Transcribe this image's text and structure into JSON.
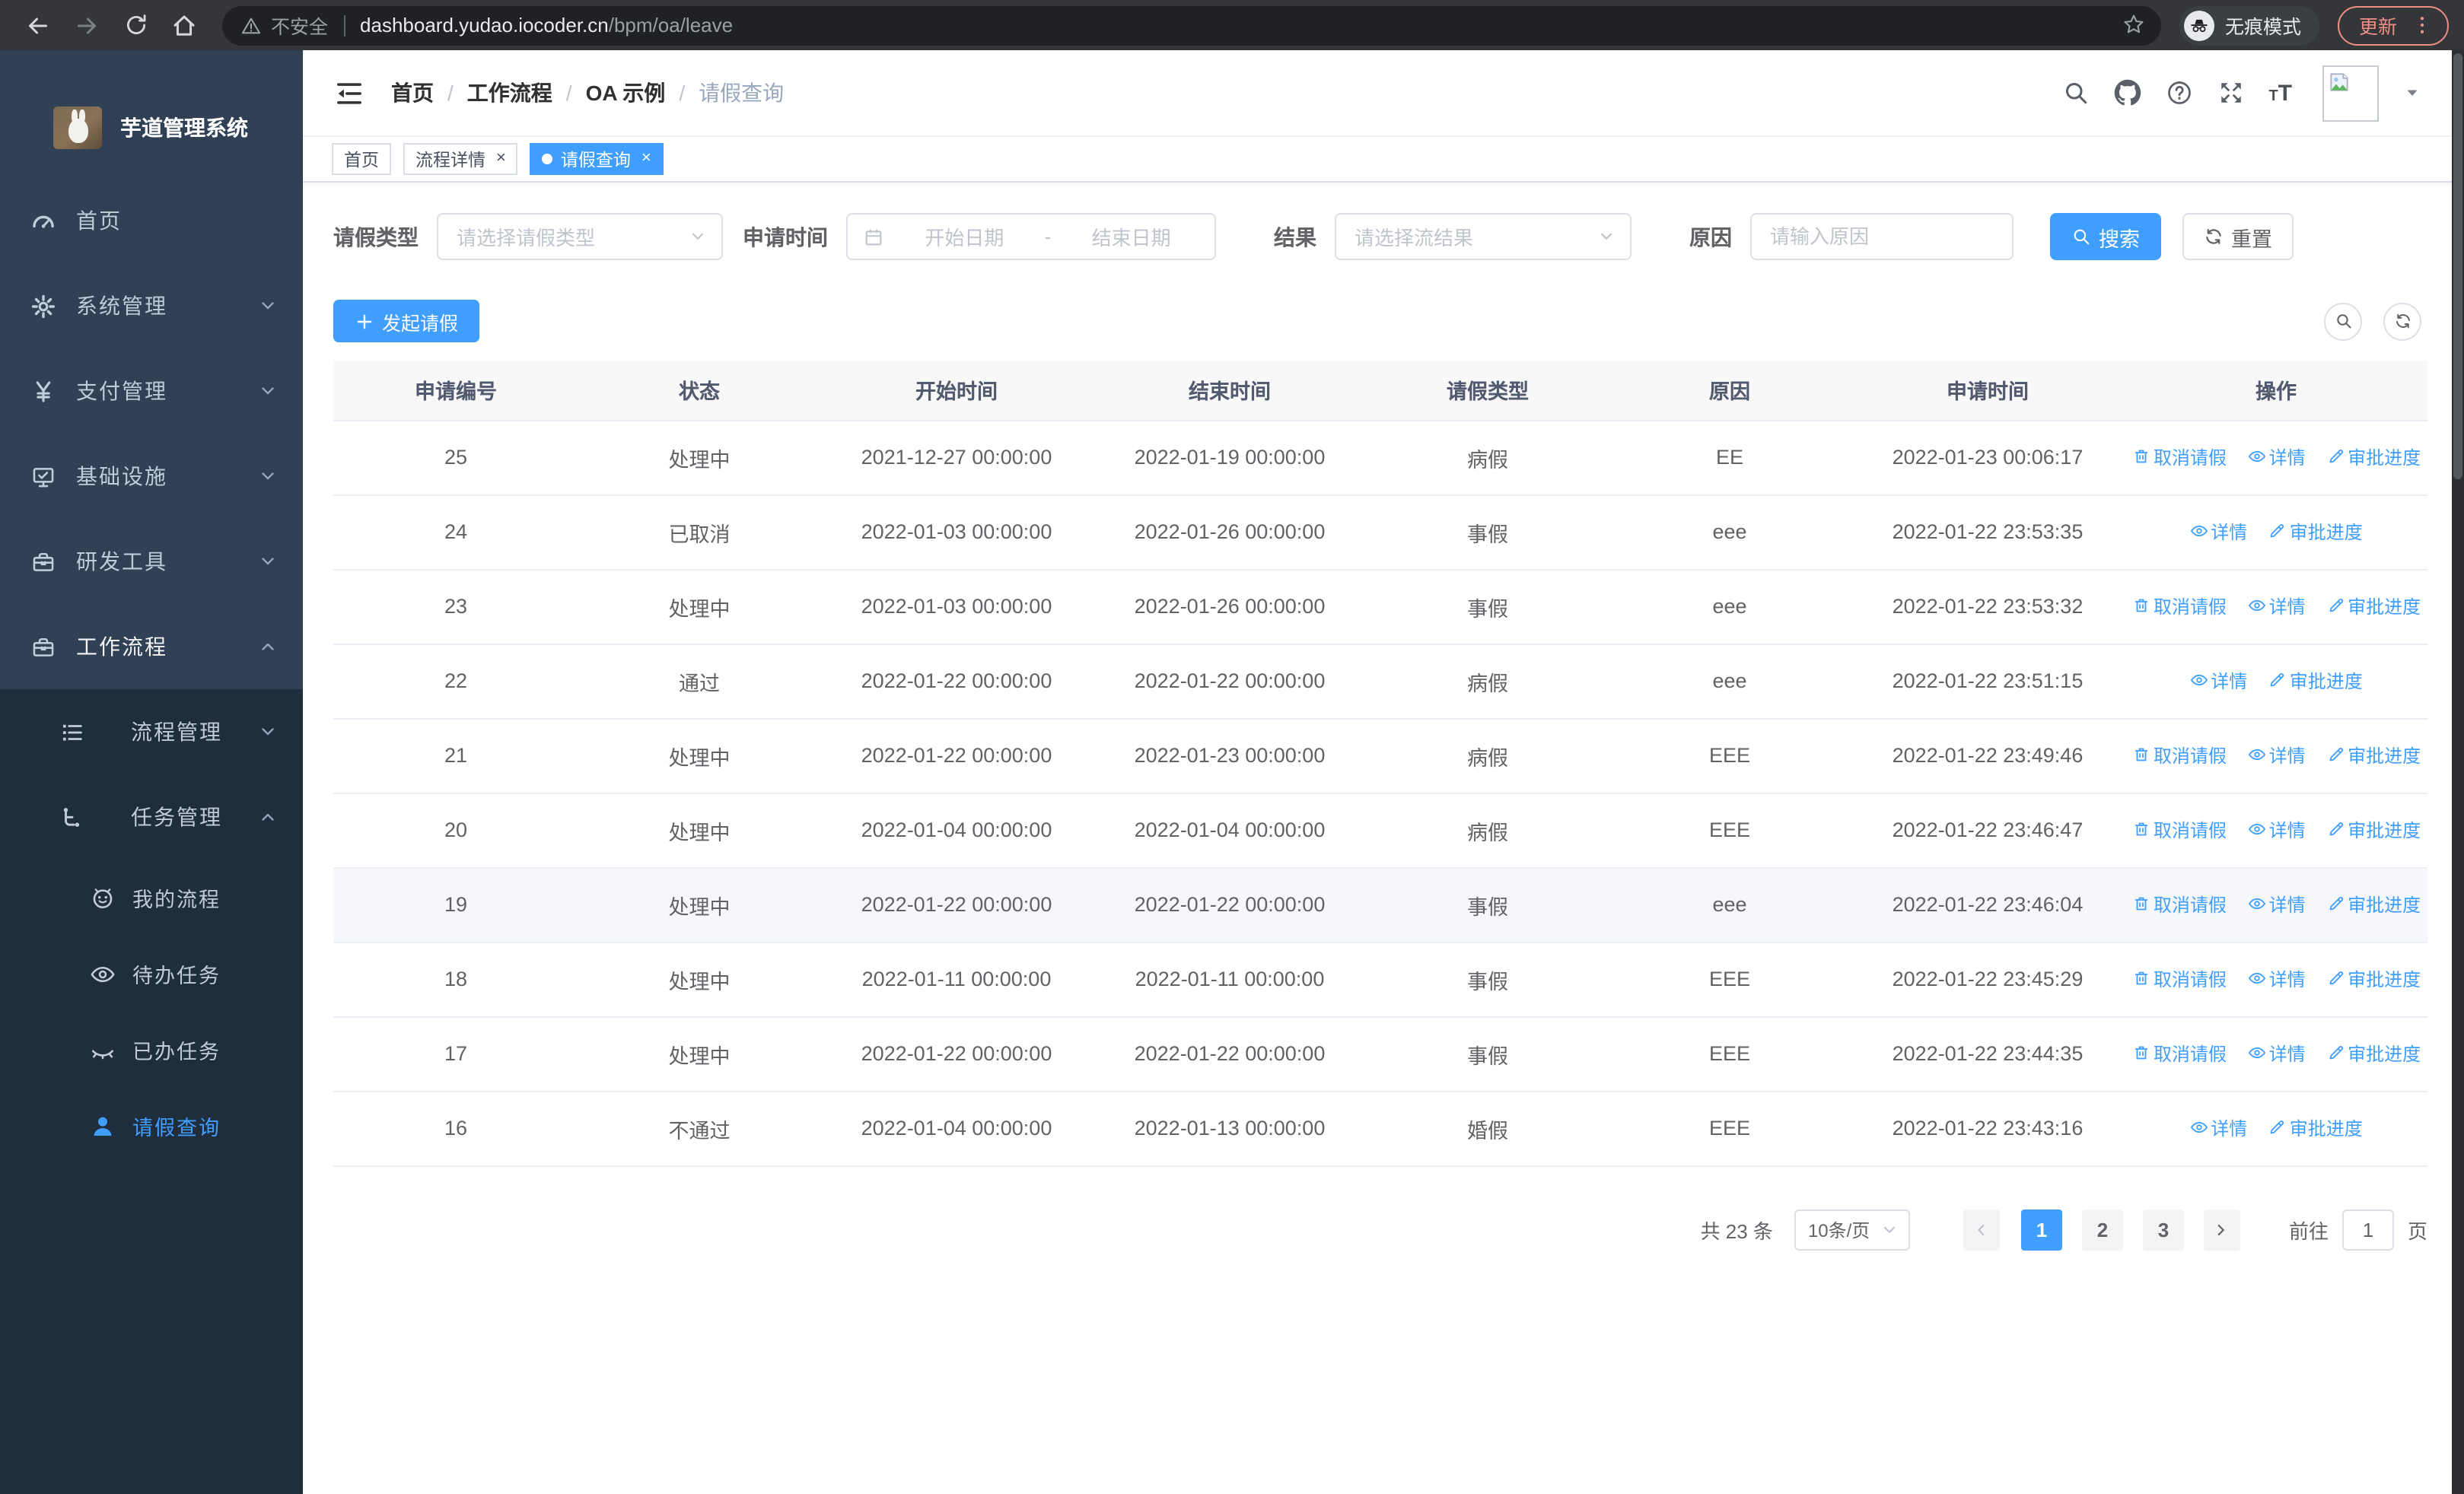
{
  "colors": {
    "accent": "#409eff",
    "sidebar_bg": "#304156",
    "submenu_bg": "#1f2d3d",
    "sidebar_text": "#bfcbd9",
    "link": "#409eff",
    "update_badge": "#ee9087"
  },
  "browser": {
    "security_label": "不安全",
    "url_host": "dashboard.yudao.iocoder.cn",
    "url_path": "/bpm/oa/leave",
    "incognito_label": "无痕模式",
    "update_label": "更新"
  },
  "sidebar": {
    "title": "芋道管理系统",
    "items": [
      {
        "label": "首页",
        "icon": "#i-gauge",
        "level": "1",
        "chevron": "none"
      },
      {
        "label": "系统管理",
        "icon": "#i-gear",
        "level": "1",
        "chevron": "down"
      },
      {
        "label": "支付管理",
        "icon": "#i-yen",
        "level": "1",
        "chevron": "down"
      },
      {
        "label": "基础设施",
        "icon": "#i-monitor",
        "level": "1",
        "chevron": "down"
      },
      {
        "label": "研发工具",
        "icon": "#i-toolbox",
        "level": "1",
        "chevron": "down"
      },
      {
        "label": "工作流程",
        "icon": "#i-toolbox",
        "level": "1",
        "chevron": "up",
        "open": "true"
      },
      {
        "label": "流程管理",
        "icon": "#i-tree",
        "level": "2",
        "chevron": "down"
      },
      {
        "label": "任务管理",
        "icon": "#i-flow",
        "level": "2",
        "chevron": "up"
      },
      {
        "label": "我的流程",
        "icon": "#i-robot",
        "level": "3",
        "chevron": "none"
      },
      {
        "label": "待办任务",
        "icon": "#i-eye",
        "level": "3",
        "chevron": "none"
      },
      {
        "label": "已办任务",
        "icon": "#i-eyeclosed",
        "level": "3",
        "chevron": "none"
      },
      {
        "label": "请假查询",
        "icon": "#i-user",
        "level": "3",
        "chevron": "none",
        "active": "true"
      }
    ]
  },
  "header": {
    "breadcrumb": [
      {
        "label": "首页"
      },
      {
        "label": "工作流程"
      },
      {
        "label": "OA 示例"
      },
      {
        "label": "请假查询"
      }
    ]
  },
  "tabs": [
    {
      "label": "首页"
    },
    {
      "label": "流程详情",
      "closable": "true"
    },
    {
      "label": "请假查询",
      "closable": "true",
      "active": "true"
    }
  ],
  "filters": {
    "type_label": "请假类型",
    "type_placeholder": "请选择请假类型",
    "time_label": "申请时间",
    "start_placeholder": "开始日期",
    "range_separator": "-",
    "end_placeholder": "结束日期",
    "result_label": "结果",
    "result_placeholder": "请选择流结果",
    "reason_label": "原因",
    "reason_placeholder": "请输入原因",
    "search_label": "搜索",
    "reset_label": "重置"
  },
  "toolbar": {
    "create_label": "发起请假"
  },
  "table": {
    "columns": [
      {
        "label": "申请编号"
      },
      {
        "label": "状态"
      },
      {
        "label": "开始时间"
      },
      {
        "label": "结束时间"
      },
      {
        "label": "请假类型"
      },
      {
        "label": "原因"
      },
      {
        "label": "申请时间"
      },
      {
        "label": "操作"
      }
    ],
    "action_labels": {
      "cancel": "取消请假",
      "detail": "详情",
      "progress": "审批进度"
    },
    "rows": [
      {
        "id": "25",
        "status": "处理中",
        "start": "2021-12-27 00:00:00",
        "end": "2022-01-19 00:00:00",
        "type": "病假",
        "reason": "EE",
        "applied": "2022-01-23 00:06:17",
        "can_cancel": true
      },
      {
        "id": "24",
        "status": "已取消",
        "start": "2022-01-03 00:00:00",
        "end": "2022-01-26 00:00:00",
        "type": "事假",
        "reason": "eee",
        "applied": "2022-01-22 23:53:35",
        "can_cancel": false
      },
      {
        "id": "23",
        "status": "处理中",
        "start": "2022-01-03 00:00:00",
        "end": "2022-01-26 00:00:00",
        "type": "事假",
        "reason": "eee",
        "applied": "2022-01-22 23:53:32",
        "can_cancel": true
      },
      {
        "id": "22",
        "status": "通过",
        "start": "2022-01-22 00:00:00",
        "end": "2022-01-22 00:00:00",
        "type": "病假",
        "reason": "eee",
        "applied": "2022-01-22 23:51:15",
        "can_cancel": false
      },
      {
        "id": "21",
        "status": "处理中",
        "start": "2022-01-22 00:00:00",
        "end": "2022-01-23 00:00:00",
        "type": "病假",
        "reason": "EEE",
        "applied": "2022-01-22 23:49:46",
        "can_cancel": true
      },
      {
        "id": "20",
        "status": "处理中",
        "start": "2022-01-04 00:00:00",
        "end": "2022-01-04 00:00:00",
        "type": "病假",
        "reason": "EEE",
        "applied": "2022-01-22 23:46:47",
        "can_cancel": true
      },
      {
        "id": "19",
        "status": "处理中",
        "start": "2022-01-22 00:00:00",
        "end": "2022-01-22 00:00:00",
        "type": "事假",
        "reason": "eee",
        "applied": "2022-01-22 23:46:04",
        "can_cancel": true,
        "hover": "true"
      },
      {
        "id": "18",
        "status": "处理中",
        "start": "2022-01-11 00:00:00",
        "end": "2022-01-11 00:00:00",
        "type": "事假",
        "reason": "EEE",
        "applied": "2022-01-22 23:45:29",
        "can_cancel": true
      },
      {
        "id": "17",
        "status": "处理中",
        "start": "2022-01-22 00:00:00",
        "end": "2022-01-22 00:00:00",
        "type": "事假",
        "reason": "EEE",
        "applied": "2022-01-22 23:44:35",
        "can_cancel": true
      },
      {
        "id": "16",
        "status": "不通过",
        "start": "2022-01-04 00:00:00",
        "end": "2022-01-13 00:00:00",
        "type": "婚假",
        "reason": "EEE",
        "applied": "2022-01-22 23:43:16",
        "can_cancel": false
      }
    ]
  },
  "pagination": {
    "total_label": "共 23 条",
    "page_size_label": "10条/页",
    "pages": [
      {
        "n": "1",
        "active": "true"
      },
      {
        "n": "2"
      },
      {
        "n": "3"
      }
    ],
    "goto_label": "前往",
    "goto_value": "1",
    "page_unit": "页"
  }
}
